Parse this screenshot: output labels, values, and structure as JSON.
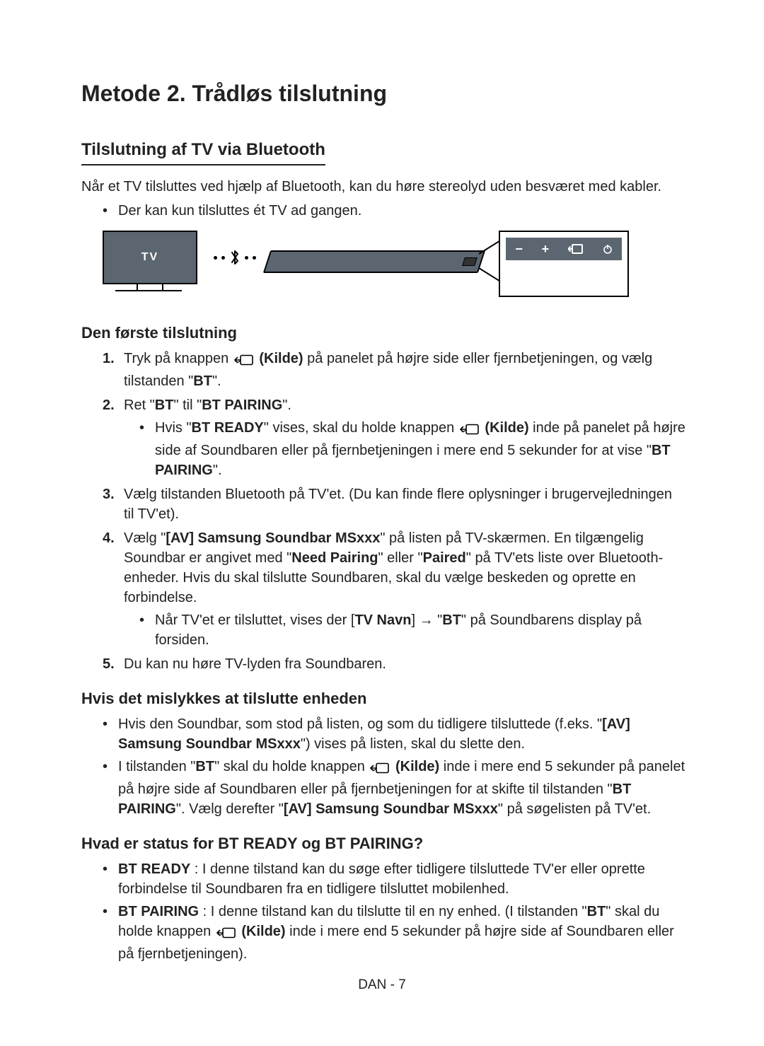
{
  "title": "Metode 2. Trådløs tilslutning",
  "section1": {
    "heading": "Tilslutning af TV via Bluetooth"
  },
  "diagram": {
    "tv_label": "TV"
  },
  "sub1": {
    "heading": "Den første tilslutning"
  },
  "sub2": {
    "heading": "Hvis det mislykkes at tilslutte enheden"
  },
  "sub3": {
    "heading": "Hvad er status for BT READY og BT PAIRING?"
  },
  "footer": "DAN - 7"
}
